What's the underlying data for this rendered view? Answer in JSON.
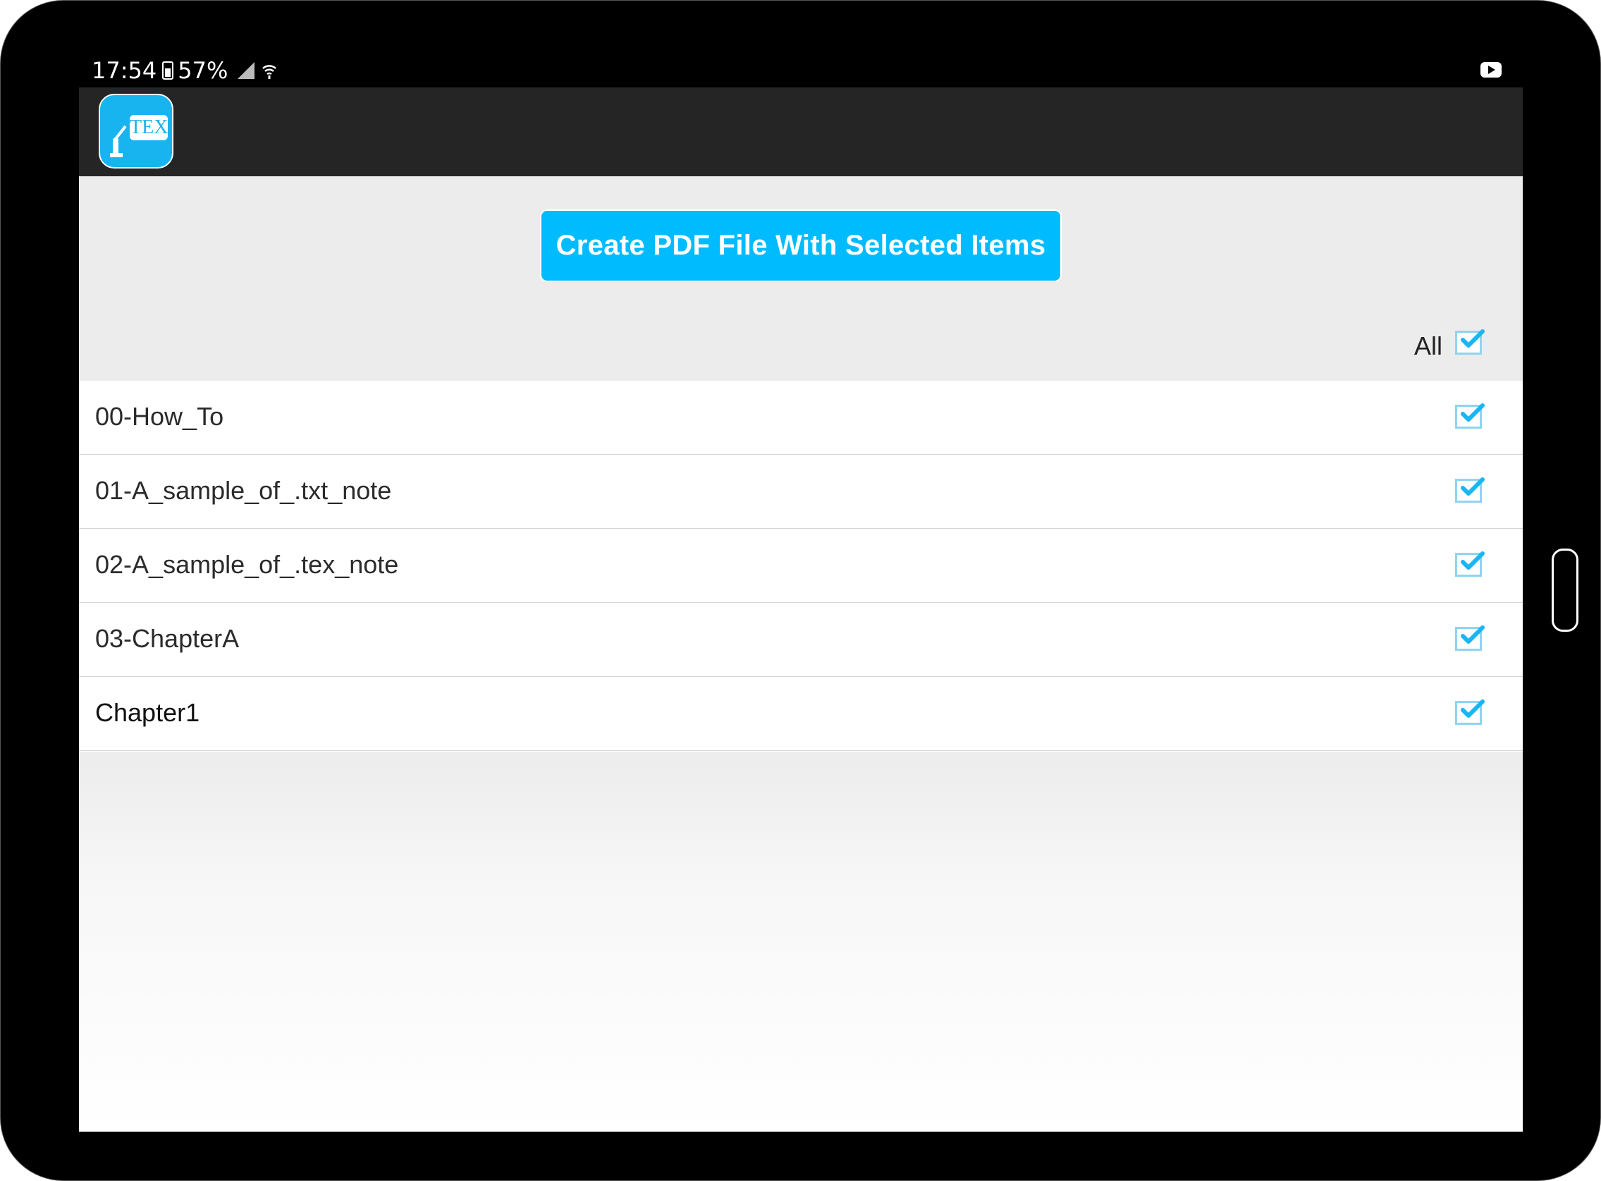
{
  "status_bar": {
    "time": "17:54",
    "battery": "57%",
    "icons": [
      "battery-icon",
      "signal-icon",
      "wifi-icon",
      "youtube-icon"
    ]
  },
  "toolbar": {
    "logo_text": "TEX",
    "logo_icon": "app-logo-icon"
  },
  "header": {
    "create_button_label": "Create PDF File With Selected Items",
    "all_label": "All",
    "all_checked": true
  },
  "list": {
    "items": [
      {
        "label": "00-How_To",
        "checked": true
      },
      {
        "label": "01-A_sample_of_.txt_note",
        "checked": true
      },
      {
        "label": "02-A_sample_of_.tex_note",
        "checked": true
      },
      {
        "label": "03-ChapterA",
        "checked": true
      },
      {
        "label": "Chapter1",
        "checked": true
      }
    ]
  },
  "colors": {
    "accent": "#00bcff",
    "toolbar": "#252525",
    "header_bg": "#ececec",
    "check": "#19b6f2"
  }
}
